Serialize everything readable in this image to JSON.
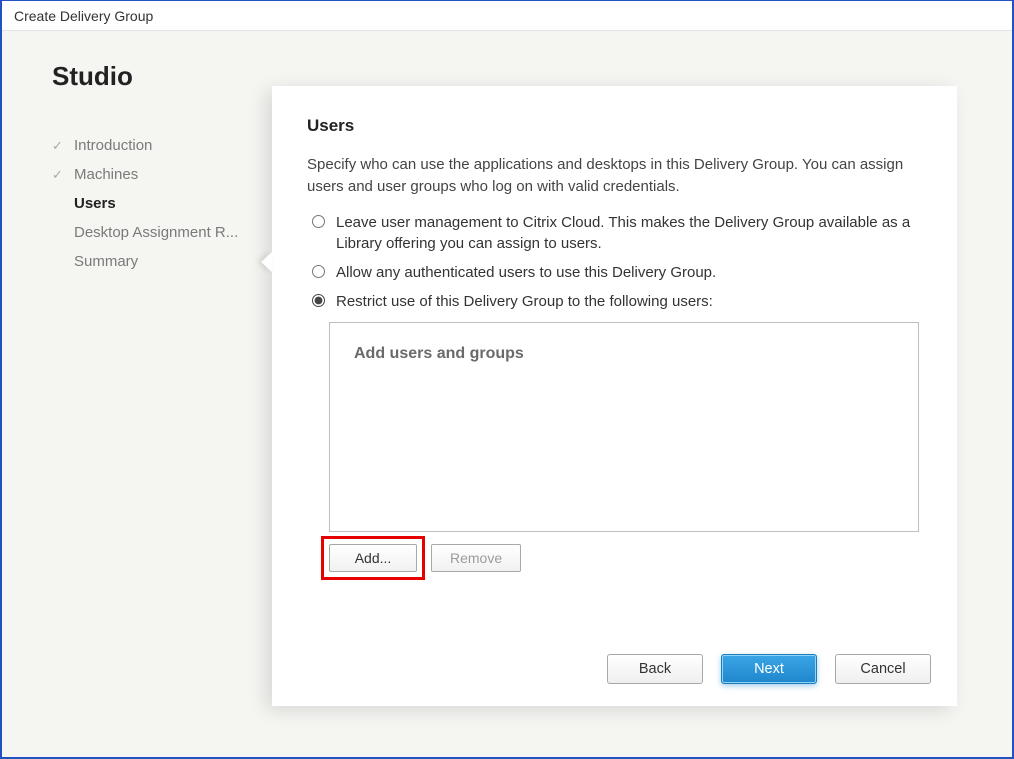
{
  "window": {
    "title": "Create Delivery Group"
  },
  "sidebar": {
    "title": "Studio",
    "items": [
      {
        "label": "Introduction",
        "completed": true,
        "active": false
      },
      {
        "label": "Machines",
        "completed": true,
        "active": false
      },
      {
        "label": "Users",
        "completed": false,
        "active": true
      },
      {
        "label": "Desktop Assignment R...",
        "completed": false,
        "active": false
      },
      {
        "label": "Summary",
        "completed": false,
        "active": false
      }
    ]
  },
  "main": {
    "heading": "Users",
    "description": "Specify who can use the applications and desktops in this Delivery Group. You can assign users and user groups who log on with valid credentials.",
    "options": [
      {
        "label": "Leave user management to Citrix Cloud. This makes the Delivery Group available as a Library offering you can assign to users.",
        "selected": false
      },
      {
        "label": "Allow any authenticated users to use this Delivery Group.",
        "selected": false
      },
      {
        "label": "Restrict use of this Delivery Group to the following users:",
        "selected": true
      }
    ],
    "users_box_placeholder": "Add users and groups",
    "buttons": {
      "add": "Add...",
      "remove": "Remove"
    }
  },
  "footer": {
    "back": "Back",
    "next": "Next",
    "cancel": "Cancel"
  }
}
